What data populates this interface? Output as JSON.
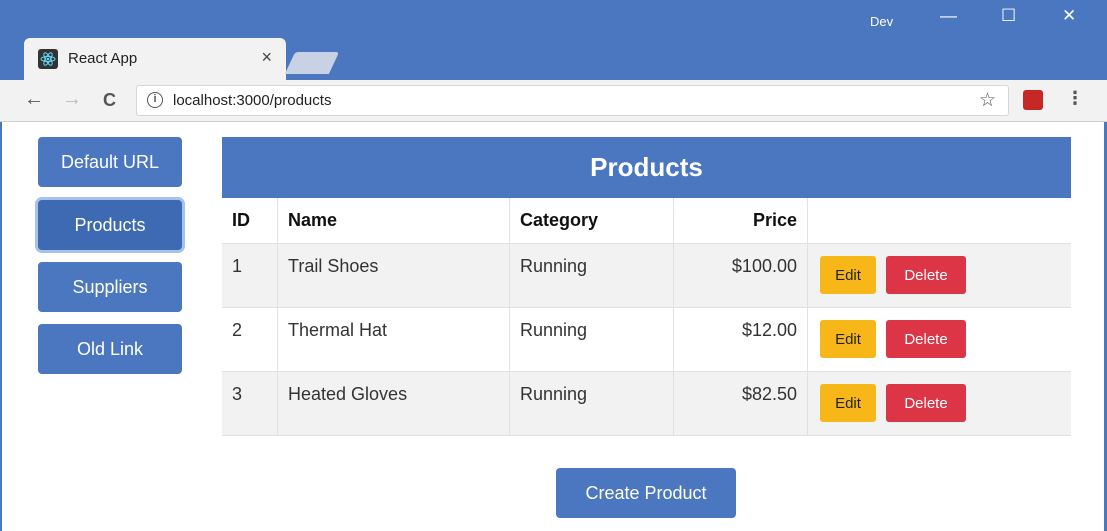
{
  "browser": {
    "tab_title": "React App",
    "tab_close": "×",
    "user_label": "Dev",
    "url_host": "localhost:3000/products",
    "min_glyph": "—",
    "max_glyph": "☐",
    "close_glyph": "✕",
    "back_glyph": "←",
    "forward_glyph": "→",
    "reload_glyph": "C",
    "info_glyph": "i",
    "star_glyph": "☆",
    "menu_glyph": "⋮"
  },
  "sidebar": {
    "items": [
      {
        "label": "Default URL"
      },
      {
        "label": "Products"
      },
      {
        "label": "Suppliers"
      },
      {
        "label": "Old Link"
      }
    ]
  },
  "table": {
    "title": "Products",
    "headers": [
      "ID",
      "Name",
      "Category",
      "Price",
      ""
    ],
    "rows": [
      {
        "id": "1",
        "name": "Trail Shoes",
        "category": "Running",
        "price": "$100.00"
      },
      {
        "id": "2",
        "name": "Thermal Hat",
        "category": "Running",
        "price": "$12.00"
      },
      {
        "id": "3",
        "name": "Heated Gloves",
        "category": "Running",
        "price": "$82.50"
      }
    ],
    "edit_label": "Edit",
    "delete_label": "Delete"
  },
  "create_label": "Create Product",
  "colors": {
    "primary": "#4a77bf",
    "warning": "#f7b718",
    "danger": "#dc3545"
  }
}
